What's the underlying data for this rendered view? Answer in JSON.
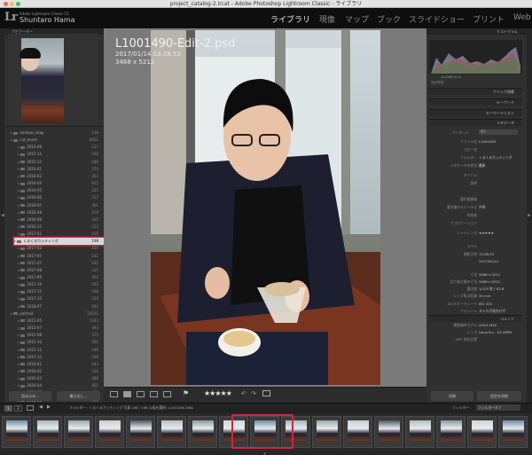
{
  "window": {
    "title": "project_catalog-2.lrcat - Adobe Photoshop Lightroom Classic - ライブラリ"
  },
  "identity": {
    "logo": "Lr",
    "product": "Adobe Lightroom Classic CC",
    "user": "Shuntaro Hama"
  },
  "modules": [
    {
      "label": "ライブラリ",
      "active": true
    },
    {
      "label": "現像",
      "active": false
    },
    {
      "label": "マップ",
      "active": false
    },
    {
      "label": "ブック",
      "active": false
    },
    {
      "label": "スライドショー",
      "active": false
    },
    {
      "label": "プリント",
      "active": false
    },
    {
      "label": "Web",
      "active": false
    }
  ],
  "left_panel": {
    "navigator_label": "ナビゲーター",
    "folders": [
      {
        "name": "airshow_snap",
        "count": "518"
      },
      {
        "name": "cut_event",
        "count": "6952"
      },
      {
        "name": "2015-09",
        "count": "117"
      },
      {
        "name": "2015-11",
        "count": "336"
      },
      {
        "name": "2015-12",
        "count": "186"
      },
      {
        "name": "2016-01",
        "count": "274"
      },
      {
        "name": "2016-02",
        "count": "353"
      },
      {
        "name": "2016-04",
        "count": "615"
      },
      {
        "name": "2016-05",
        "count": "225"
      },
      {
        "name": "2016-06",
        "count": "217"
      },
      {
        "name": "2016-07",
        "count": "361"
      },
      {
        "name": "2016-08",
        "count": "418"
      },
      {
        "name": "2016-09",
        "count": "415"
      },
      {
        "name": "2016-12",
        "count": "213"
      },
      {
        "name": "2017-01",
        "count": "410"
      },
      {
        "name": "くるくるカッティング",
        "count": "198",
        "selected": true
      },
      {
        "name": "2017-03",
        "count": "434"
      },
      {
        "name": "2017-05",
        "count": "232"
      },
      {
        "name": "2017-07",
        "count": "192"
      },
      {
        "name": "2017-08",
        "count": "125"
      },
      {
        "name": "2017-09",
        "count": "262"
      },
      {
        "name": "2017-10",
        "count": "193"
      },
      {
        "name": "2017-11",
        "count": "198"
      },
      {
        "name": "2017-12",
        "count": "234"
      },
      {
        "name": "2018-07",
        "count": "164"
      },
      {
        "name": "portrait",
        "count": "23551"
      },
      {
        "name": "2015-05",
        "count": "1343"
      },
      {
        "name": "2015-07",
        "count": "593"
      },
      {
        "name": "2015-08",
        "count": "375"
      },
      {
        "name": "2015-10",
        "count": "262"
      },
      {
        "name": "2015-11",
        "count": "249"
      },
      {
        "name": "2015-12",
        "count": "549"
      },
      {
        "name": "2016-01",
        "count": "443"
      },
      {
        "name": "2016-02",
        "count": "338"
      },
      {
        "name": "2016-03",
        "count": "488"
      },
      {
        "name": "2016-04",
        "count": "451"
      },
      {
        "name": "2016-05",
        "count": "422"
      },
      {
        "name": "2016-06",
        "count": "401"
      }
    ],
    "import_btn": "読み込み...",
    "export_btn": "書き出し..."
  },
  "photo": {
    "filename": "L1001490-Edit-2.psd",
    "datetime": "2017/01/14 13:28:53",
    "dimensions": "3468 x 5212"
  },
  "toolbar": {
    "rating": "★★★★★"
  },
  "right_panel": {
    "histogram_label": "ヒストグラム",
    "histogram_info": "1/125秒   f/2.8",
    "original_photo": "元の写真",
    "quick_develop": "クイック現像",
    "keywords": "キーワード",
    "keyword_list": "キーワードリスト",
    "metadata": "メタデータ",
    "preset_label": "プリセット",
    "preset_value": "なし",
    "meta_rows": [
      {
        "label": "ファイル名",
        "value": "L1001490"
      },
      {
        "label": "コピー名",
        "value": ""
      },
      {
        "label": "フォルダー",
        "value": "くるくるカッティング"
      },
      {
        "label": "メタデータの状況",
        "value": "最新"
      },
      {
        "label": "タイトル",
        "value": ""
      },
      {
        "label": "説明",
        "value": ""
      },
      {
        "label": "著作権情報",
        "value": ""
      },
      {
        "label": "著作権のステータス",
        "value": "不明"
      },
      {
        "label": "作成者",
        "value": ""
      },
      {
        "label": "サブロケーション",
        "value": ""
      },
      {
        "label": "レーティング",
        "value": "★★★★★"
      },
      {
        "label": "ラベル",
        "value": ""
      },
      {
        "label": "撮影日時",
        "value": "13:28:53"
      },
      {
        "label": "",
        "value": "2017/01/14"
      },
      {
        "label": "寸法",
        "value": "3468 x 5212"
      },
      {
        "label": "切り抜き後の寸法",
        "value": "3468 x 5212"
      },
      {
        "label": "露出量",
        "value": "1/125 秒 / f/2.8"
      },
      {
        "label": "レンズ焦点距離",
        "value": "35 mm"
      },
      {
        "label": "ISOスピードレート",
        "value": "ISO 320"
      },
      {
        "label": "フラッシュ",
        "value": "ストロボ発光せず"
      },
      {
        "label": "撮影機材メーカー",
        "value": "Leica"
      },
      {
        "label": "撮影機材モデル",
        "value": "LEICA M10"
      },
      {
        "label": "レンズ",
        "value": "Leica Su... f/2 ASPH."
      },
      {
        "label": "GPS 測位位置",
        "value": ""
      }
    ],
    "comments": "コメント",
    "sync_btn": "同期",
    "sync_settings_btn": "設定を同期"
  },
  "filmstrip": {
    "page_numbers": [
      "1",
      "2"
    ],
    "info": "フォルダー : くるくるカッティング   写真 198 / 198 (1枚を選択)   L1001490.DNG",
    "filter_label": "フィルター :",
    "filter_value": "フィルターオフ"
  }
}
